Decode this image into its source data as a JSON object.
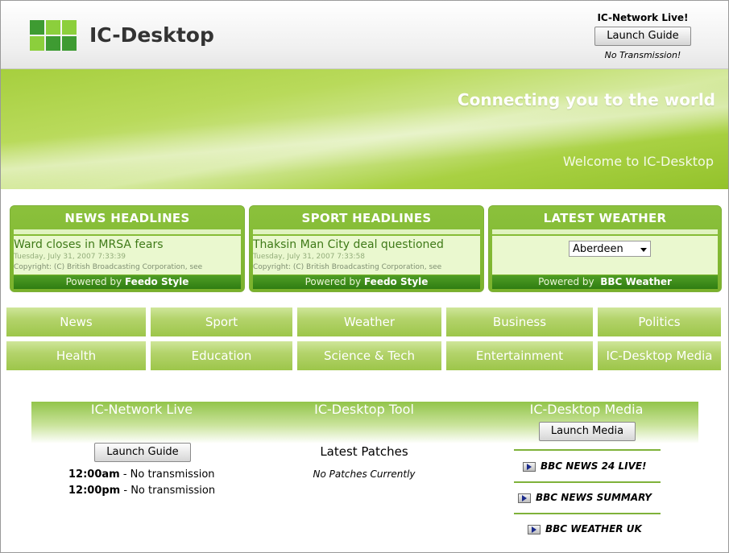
{
  "header": {
    "app_title": "IC-Desktop",
    "live_title": "IC-Network Live!",
    "launch_guide": "Launch Guide",
    "status": "No Transmission!"
  },
  "banner": {
    "tagline": "Connecting you to the world",
    "welcome": "Welcome to IC-Desktop"
  },
  "panels": {
    "news": {
      "title": "NEWS HEADLINES",
      "headline": "Ward closes in MRSA fears",
      "date": "Tuesday, July 31, 2007 7:33:39",
      "copyright": "Copyright: (C) British Broadcasting Corporation, see",
      "powered_prefix": "Powered by",
      "powered_name": "Feedo Style"
    },
    "sport": {
      "title": "SPORT HEADLINES",
      "headline": "Thaksin Man City deal questioned",
      "date": "Tuesday, July 31, 2007 7:33:58",
      "copyright": "Copyright: (C) British Broadcasting Corporation, see",
      "powered_prefix": "Powered by",
      "powered_name": "Feedo Style"
    },
    "weather": {
      "title": "LATEST WEATHER",
      "selected_city": "Aberdeen",
      "powered_prefix": "Powered by",
      "powered_name": "BBC Weather"
    }
  },
  "nav": {
    "row1": [
      "News",
      "Sport",
      "Weather",
      "Business",
      "Politics"
    ],
    "row2": [
      "Health",
      "Education",
      "Science & Tech",
      "Entertainment",
      "IC-Desktop Media"
    ]
  },
  "lower": {
    "network_live": {
      "heading": "IC-Network Live",
      "launch_guide": "Launch Guide",
      "schedule": [
        {
          "time": "12:00am",
          "sep": " - ",
          "text": "No transmission"
        },
        {
          "time": "12:00pm",
          "sep": " - ",
          "text": "No transmission"
        }
      ]
    },
    "tool": {
      "heading": "IC-Desktop Tool",
      "patches_title": "Latest Patches",
      "patches_status": "No Patches Currently"
    },
    "media": {
      "heading": "IC-Desktop Media",
      "launch_media": "Launch Media",
      "links": [
        "BBC NEWS 24 LIVE!",
        "BBC NEWS SUMMARY",
        "BBC WEATHER UK"
      ]
    }
  },
  "colors": {
    "brand_green": "#3e9b32",
    "banner_green": "#a6cf3e",
    "panel_green": "#8bc13c",
    "footer_green": "#2f7d12"
  }
}
